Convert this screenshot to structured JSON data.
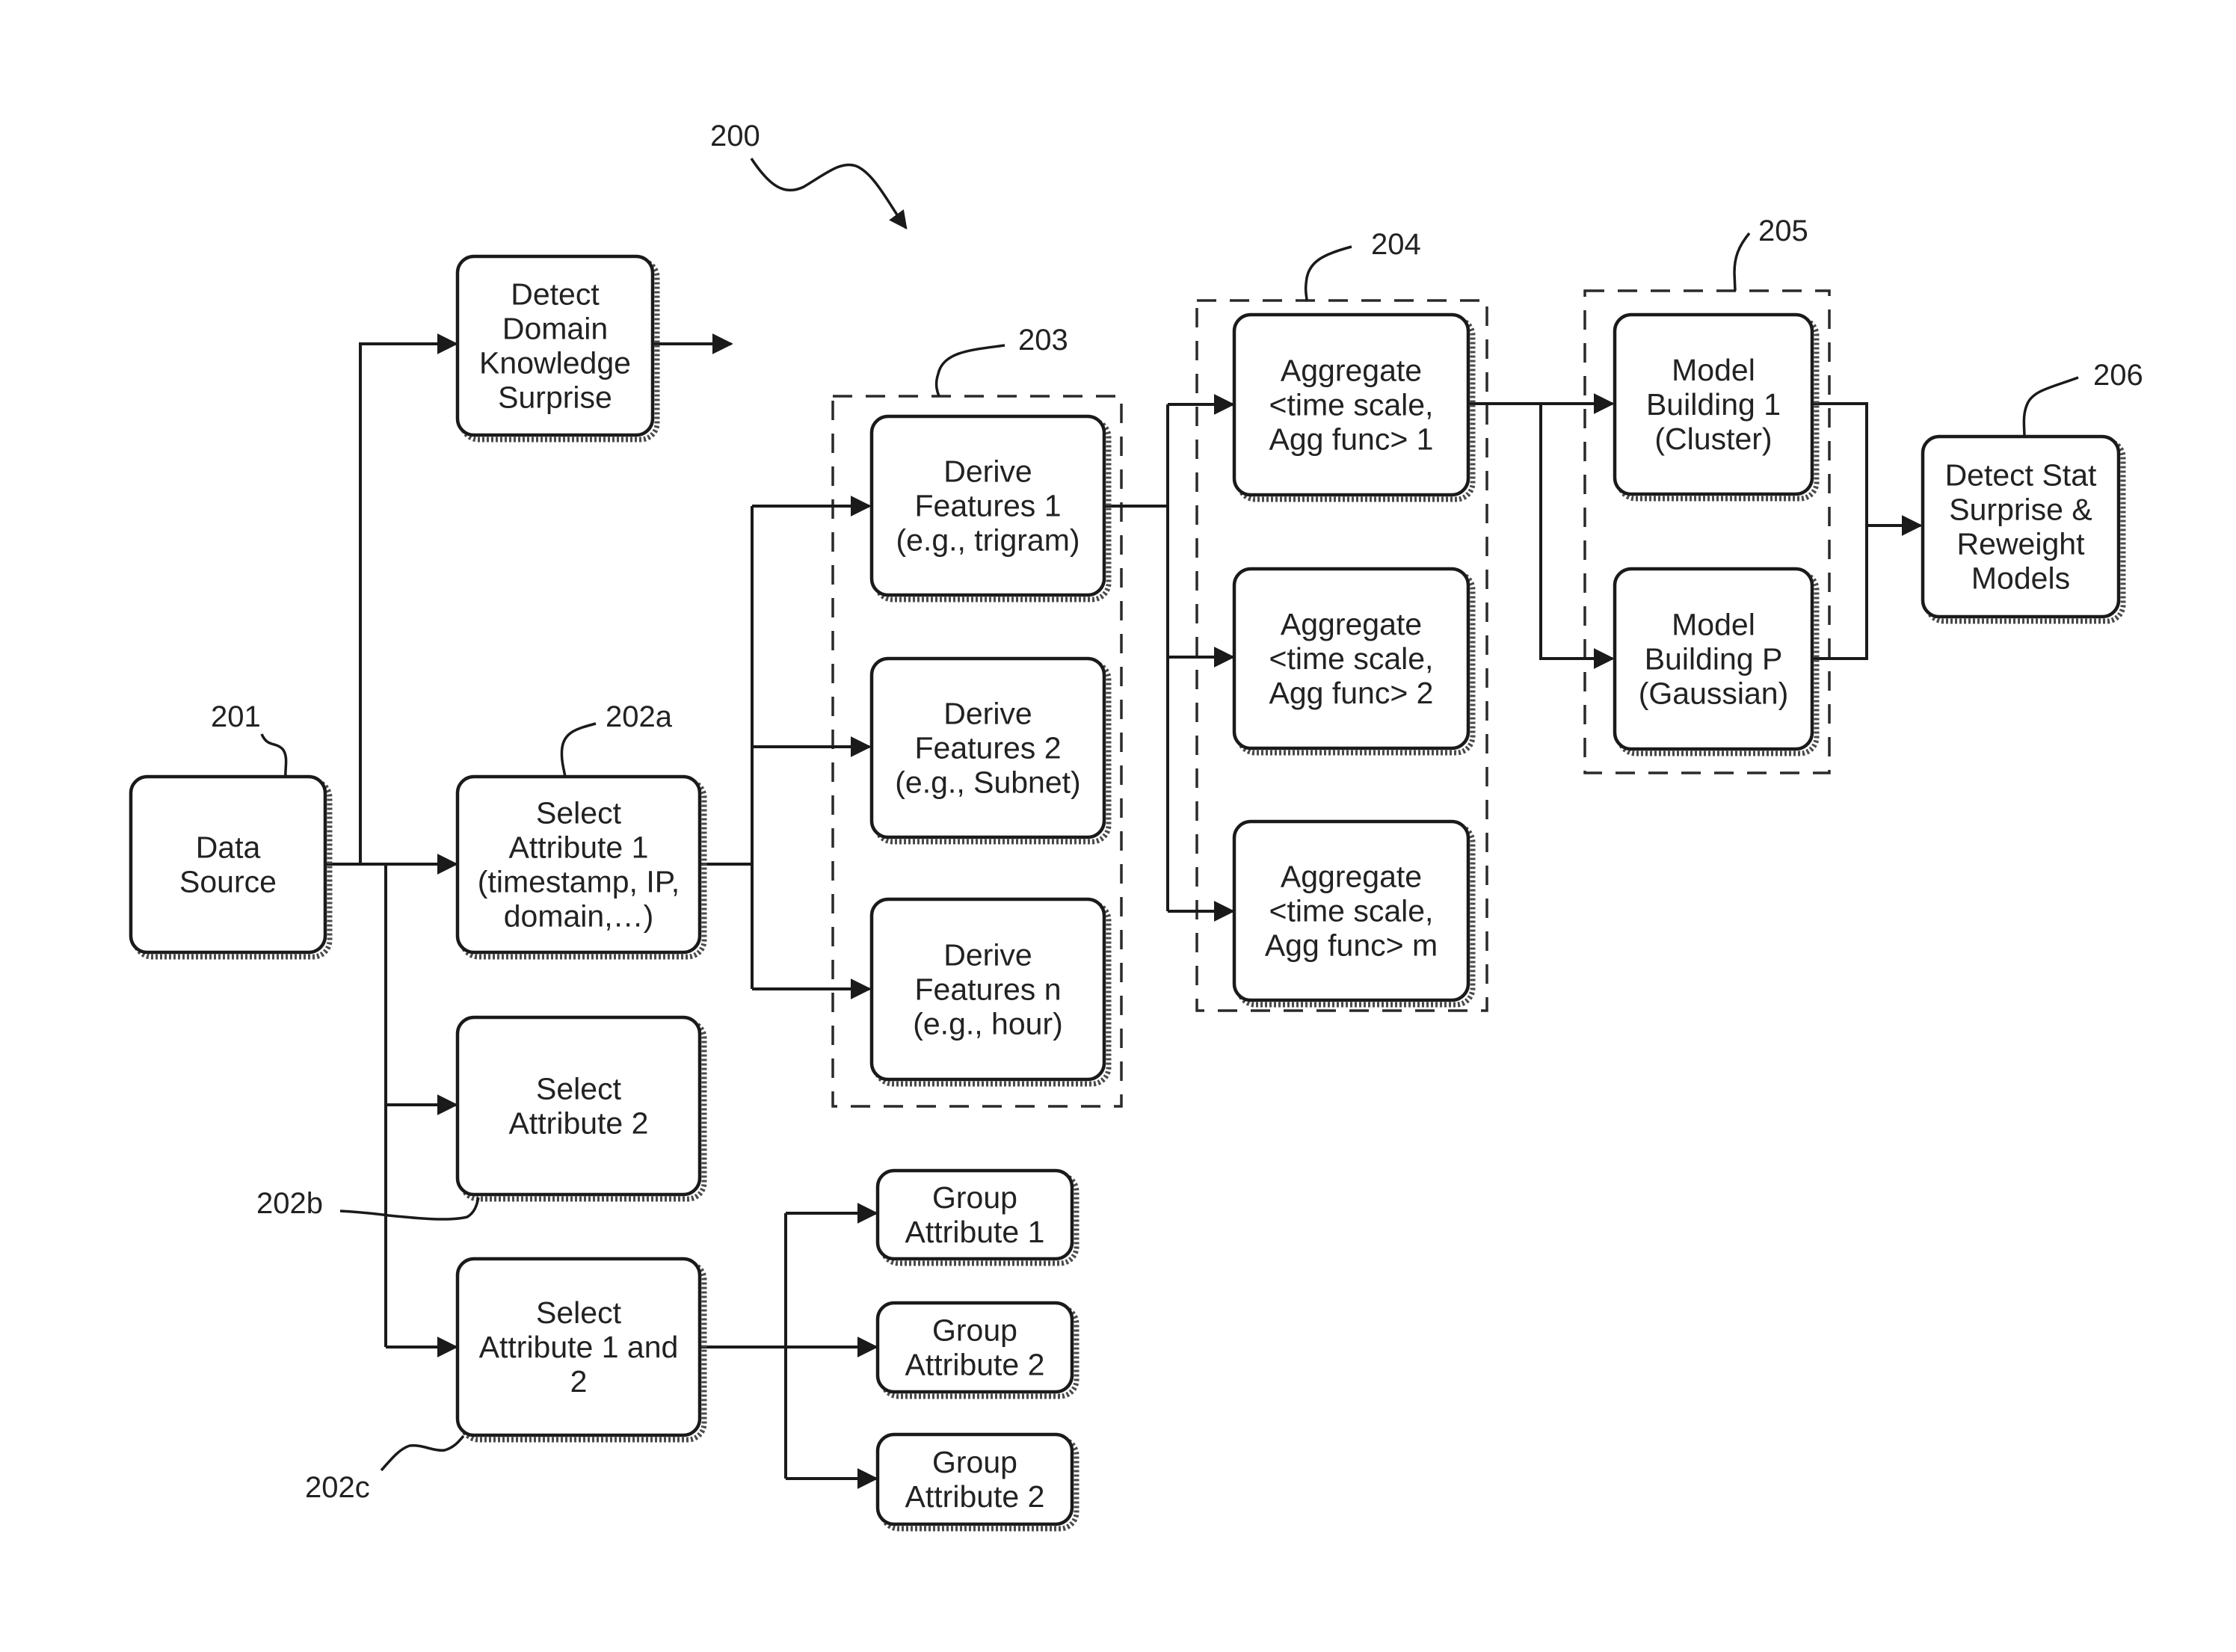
{
  "figure": {
    "reference": "200",
    "nodes": {
      "data_source": {
        "ref": "201",
        "lines": [
          "Data",
          "Source"
        ]
      },
      "detect_domain": {
        "lines": [
          "Detect",
          "Domain",
          "Knowledge",
          "Surprise"
        ]
      },
      "select_attr_1": {
        "ref": "202a",
        "lines": [
          "Select",
          "Attribute 1",
          "(timestamp, IP,",
          "domain,…)"
        ]
      },
      "select_attr_2": {
        "ref": "202b",
        "lines": [
          "Select",
          "Attribute 2"
        ]
      },
      "select_attr_1_2": {
        "ref": "202c",
        "lines": [
          "Select",
          "Attribute 1 and",
          "2"
        ]
      },
      "derive_1": {
        "lines": [
          "Derive",
          "Features 1",
          "(e.g., trigram)"
        ]
      },
      "derive_2": {
        "lines": [
          "Derive",
          "Features 2",
          "(e.g., Subnet)"
        ]
      },
      "derive_n": {
        "lines": [
          "Derive",
          "Features n",
          "(e.g., hour)"
        ]
      },
      "aggregate_1": {
        "lines": [
          "Aggregate",
          "<time scale,",
          "Agg func> 1"
        ]
      },
      "aggregate_2": {
        "lines": [
          "Aggregate",
          "<time scale,",
          "Agg func> 2"
        ]
      },
      "aggregate_m": {
        "lines": [
          "Aggregate",
          "<time scale,",
          "Agg func> m"
        ]
      },
      "model_1": {
        "lines": [
          "Model",
          "Building 1",
          "(Cluster)"
        ]
      },
      "model_p": {
        "lines": [
          "Model",
          "Building P",
          "(Gaussian)"
        ]
      },
      "detect_stat": {
        "ref": "206",
        "lines": [
          "Detect Stat",
          "Surprise &",
          "Reweight",
          "Models"
        ]
      },
      "group_1": {
        "lines": [
          "Group",
          "Attribute 1"
        ]
      },
      "group_2": {
        "lines": [
          "Group",
          "Attribute 2"
        ]
      },
      "group_3": {
        "lines": [
          "Group",
          "Attribute 2"
        ]
      }
    },
    "groups": {
      "derive_group": {
        "ref": "203"
      },
      "aggregate_group": {
        "ref": "204"
      },
      "model_group": {
        "ref": "205"
      }
    }
  }
}
